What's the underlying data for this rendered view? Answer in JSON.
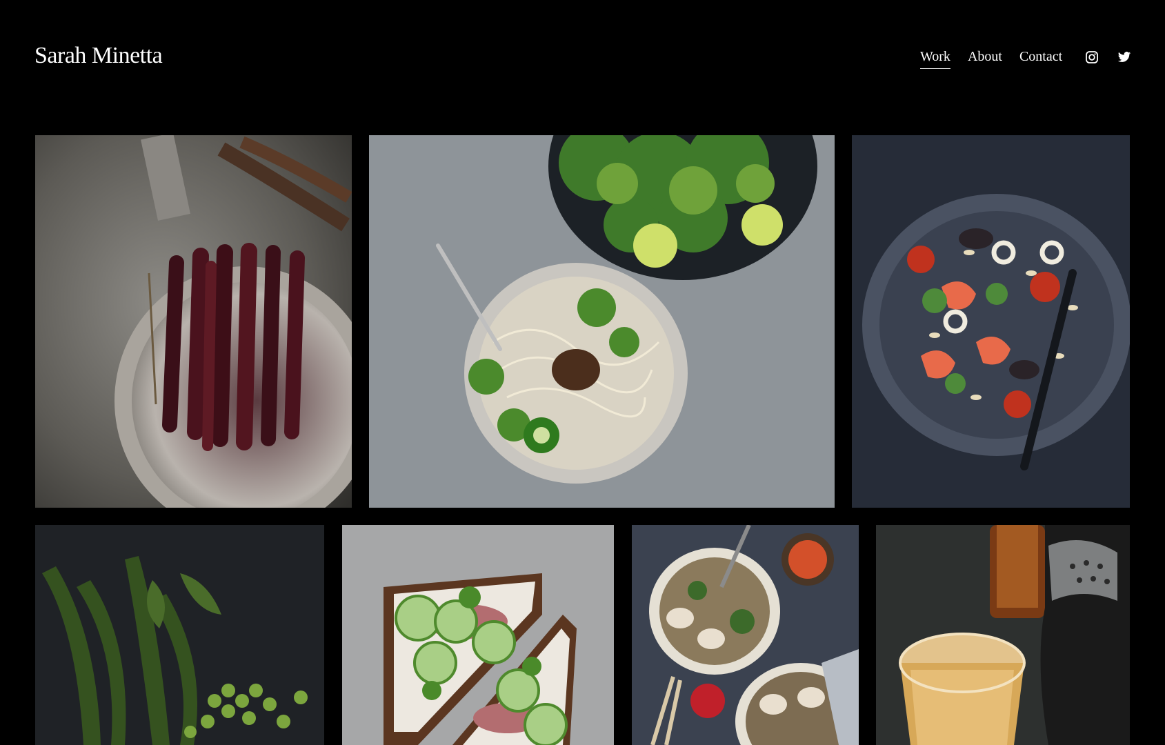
{
  "site": {
    "title": "Sarah Minetta"
  },
  "nav": {
    "items": [
      {
        "label": "Work",
        "active": true
      },
      {
        "label": "About",
        "active": false
      },
      {
        "label": "Contact",
        "active": false
      }
    ]
  },
  "social": [
    {
      "icon": "instagram-icon"
    },
    {
      "icon": "twitter-icon"
    }
  ],
  "gallery": {
    "items": [
      {
        "subject": "charred carrots in skillet"
      },
      {
        "subject": "noodle soup bowl with herbs"
      },
      {
        "subject": "seafood orzo salad plate"
      },
      {
        "subject": "green beans and peas"
      },
      {
        "subject": "open-face sandwiches with cucumber"
      },
      {
        "subject": "soba noodle soup bowls"
      },
      {
        "subject": "amber cocktail with shaker"
      }
    ]
  },
  "colors": {
    "background": "#000000",
    "text": "#ffffff"
  }
}
